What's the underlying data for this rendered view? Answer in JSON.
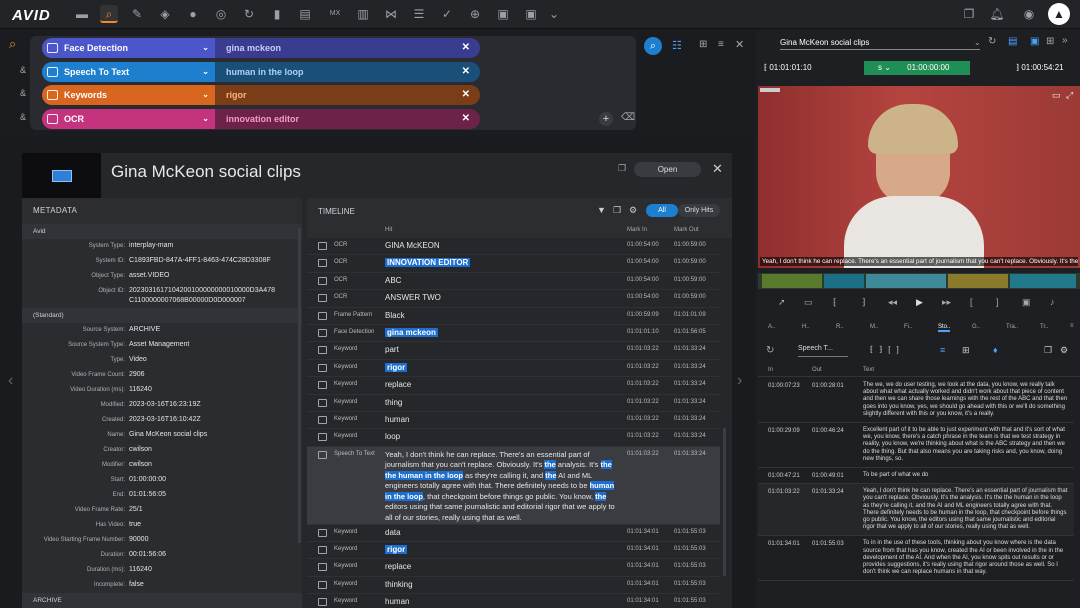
{
  "topbar": {
    "logo": "AVID",
    "icons": [
      "folder-icon",
      "search-icon",
      "edit-icon",
      "diamond-icon",
      "user-icon",
      "target-icon",
      "refresh-icon",
      "bookmark-icon",
      "list-icon",
      "mam-icon",
      "bars-icon",
      "share-icon",
      "sliders-icon",
      "check-icon",
      "globe-icon",
      "box-icon",
      "box2-icon",
      "dropdown-icon"
    ]
  },
  "search": {
    "criteria": [
      {
        "amp": "",
        "field": "Face Detection",
        "value": "gina mckeon",
        "color": "#4a56c9",
        "vcolor": "#3a3d8f",
        "vtext": "#c9cdf5"
      },
      {
        "amp": "&",
        "field": "Speech To Text",
        "value": "human in the loop",
        "color": "#1d7fce",
        "vcolor": "#1a4f7a",
        "vtext": "#a8d3f7"
      },
      {
        "amp": "&",
        "field": "Keywords",
        "value": "rigor",
        "color": "#d9661e",
        "vcolor": "#7a3d18",
        "vtext": "#ffb47a"
      },
      {
        "amp": "&",
        "field": "OCR",
        "value": "innovation editor",
        "color": "#c4337e",
        "vcolor": "#6d2249",
        "vtext": "#f29bc7"
      }
    ]
  },
  "detail": {
    "title": "Gina McKeon social clips",
    "open_label": "Open",
    "metadata_label": "METADATA",
    "timeline_label": "TIMELINE",
    "filter_all": "All",
    "filter_hits": "Only Hits",
    "col_hit": "Hit",
    "col_in": "Mark In",
    "col_out": "Mark Out",
    "meta_groups": [
      {
        "name": "Avid",
        "rows": [
          {
            "k": "System Type:",
            "v": "interplay-mam"
          },
          {
            "k": "System ID:",
            "v": "C1893FBD-847A-4FF1-8463-474C28D3308F"
          },
          {
            "k": "Object Type:",
            "v": "asset.VIDEO"
          },
          {
            "k": "Object ID:",
            "v": "2023031617104200100000000010000D3A478C1100000007068B00000D0D000007"
          }
        ]
      },
      {
        "name": "(Standard)",
        "rows": [
          {
            "k": "Source System:",
            "v": "ARCHIVE"
          },
          {
            "k": "Source System Type:",
            "v": "Asset Management"
          },
          {
            "k": "Type:",
            "v": "Video"
          },
          {
            "k": "Video Frame Count:",
            "v": "2906"
          },
          {
            "k": "Video Duration (ms):",
            "v": "116240"
          },
          {
            "k": "Modified:",
            "v": "2023-03-16T16:23:19Z"
          },
          {
            "k": "Created:",
            "v": "2023-03-16T16:10:42Z"
          },
          {
            "k": "Name:",
            "v": "Gina McKeon social clips"
          },
          {
            "k": "Creator:",
            "v": "cwilson"
          },
          {
            "k": "Modifier:",
            "v": "cwilson"
          },
          {
            "k": "Start:",
            "v": "01:00:00:00"
          },
          {
            "k": "End:",
            "v": "01:01:56:05"
          },
          {
            "k": "Video Frame Rate:",
            "v": "25/1"
          },
          {
            "k": "Has Video:",
            "v": "true"
          },
          {
            "k": "Video Starting Frame Number:",
            "v": "90000"
          },
          {
            "k": "Duration:",
            "v": "00:01:56:06"
          },
          {
            "k": "Duration (ms):",
            "v": "116240"
          },
          {
            "k": "Incomplete:",
            "v": "false"
          }
        ]
      },
      {
        "name": "ARCHIVE",
        "rows": []
      }
    ],
    "timeline_rows": [
      {
        "type": "OCR",
        "hit": "GINA McKEON",
        "hl": false,
        "in": "01:00:54:00",
        "out": "01:00:59:00"
      },
      {
        "type": "OCR",
        "hit": "INNOVATION EDITOR",
        "hl": true,
        "in": "01:00:54:00",
        "out": "01:00:59:00"
      },
      {
        "type": "OCR",
        "hit": "ABC",
        "hl": false,
        "in": "01:00:54:00",
        "out": "01:00:59:00"
      },
      {
        "type": "OCR",
        "hit": "ANSWER TWO",
        "hl": false,
        "in": "01:00:54:00",
        "out": "01:00:59:00"
      },
      {
        "type": "Frame Pattern",
        "hit": "Black",
        "hl": false,
        "in": "01:00:59:09",
        "out": "01:01:01:09"
      },
      {
        "type": "Face Detection",
        "hit": "gina mckeon",
        "hl": true,
        "in": "01:01:01:10",
        "out": "01:01:56:05"
      },
      {
        "type": "Keyword",
        "hit": "part",
        "hl": false,
        "in": "01:01:03:22",
        "out": "01:01:33:24"
      },
      {
        "type": "Keyword",
        "hit": "rigor",
        "hl": true,
        "in": "01:01:03:22",
        "out": "01:01:33:24"
      },
      {
        "type": "Keyword",
        "hit": "replace",
        "hl": false,
        "in": "01:01:03:22",
        "out": "01:01:33:24"
      },
      {
        "type": "Keyword",
        "hit": "thing",
        "hl": false,
        "in": "01:01:03:22",
        "out": "01:01:33:24"
      },
      {
        "type": "Keyword",
        "hit": "human",
        "hl": false,
        "in": "01:01:03:22",
        "out": "01:01:33:24"
      },
      {
        "type": "Keyword",
        "hit": "loop",
        "hl": false,
        "in": "01:01:03:22",
        "out": "01:01:33:24"
      }
    ],
    "speech_row": {
      "type": "Speech To Text",
      "in": "01:01:03:22",
      "out": "01:01:33:24",
      "parts": [
        [
          "Yeah, I don't think he can replace. There's an essential part of journalism that you can't replace. Obviously. It's ",
          false
        ],
        [
          "the",
          true
        ],
        [
          " analysis. It's ",
          false
        ],
        [
          "the the human in the loop",
          true
        ],
        [
          " as they're calling it, and ",
          false
        ],
        [
          "the",
          true
        ],
        [
          " AI and ML engineers totally agree with that. There definitely needs to be ",
          false
        ],
        [
          "human in the loop",
          true
        ],
        [
          ", that checkpoint before things go public. You know, ",
          false
        ],
        [
          "the",
          true
        ],
        [
          " editors using that same journalistic and editorial rigor that we apply to all of our stories, really using that as well.",
          false
        ]
      ]
    },
    "timeline_rows2": [
      {
        "type": "Keyword",
        "hit": "data",
        "hl": false,
        "in": "01:01:34:01",
        "out": "01:01:55:03"
      },
      {
        "type": "Keyword",
        "hit": "rigor",
        "hl": true,
        "in": "01:01:34:01",
        "out": "01:01:55:03"
      },
      {
        "type": "Keyword",
        "hit": "replace",
        "hl": false,
        "in": "01:01:34:01",
        "out": "01:01:55:03"
      },
      {
        "type": "Keyword",
        "hit": "thinking",
        "hl": false,
        "in": "01:01:34:01",
        "out": "01:01:55:03"
      },
      {
        "type": "Keyword",
        "hit": "human",
        "hl": false,
        "in": "01:01:34:01",
        "out": "01:01:55:03"
      }
    ]
  },
  "player": {
    "title": "Gina McKeon social clips",
    "tc_in": "01:01:01:10",
    "tc_mode": "s",
    "tc_current": "01:00:00:00",
    "tc_out": "01:00:54:21",
    "subtitle": "Yeah, I don't think he can replace. There's an essential part of journalism that you can't replace. Obviously. It's the",
    "tabs": [
      "A..",
      "H..",
      "R..",
      "M..",
      "Fi..",
      "Sto..",
      "G..",
      "Tra..",
      "Tr.."
    ],
    "track_select": "Speech T...",
    "col_in": "In",
    "col_out": "Out",
    "col_text": "Text",
    "rows": [
      {
        "in": "01:00:07:23",
        "out": "01:00:28:01",
        "text": "The we, we do user testing, we look at the data, you know, we really talk about what what actually worked and didn't work about that piece of content and then we can share those learnings with the rest of the ABC and that then goes into you know, yes, we should go ahead with this or we'll do something slightly different with this or you know, it's a really."
      },
      {
        "in": "01:00:29:09",
        "out": "01:00:46:24",
        "text": "Excellent part of it to be able to just experiment with that and it's sort of what we, you know, there's a catch phrase in the team is that we test strategy in reality, you know, we're thinking about what is the ABC strategy and then we do the thing. But that also means you are taking risks and, you know, doing new things, so."
      },
      {
        "in": "01:00:47:21",
        "out": "01:00:49:01",
        "text": "To be part of what we do"
      },
      {
        "in": "01:01:03:22",
        "out": "01:01:33:24",
        "text": "Yeah, I don't think he can replace. There's an essential part of journalism that you can't replace. Obviously. It's the analysis. It's the the human in the loop as they're calling it, and the AI and ML engineers totally agree with that. There definitely needs to be human in the loop, that checkpoint before things go public. You know, the editors using that same journalistic and editorial rigor that we apply to all of our stories, really using that as well."
      },
      {
        "in": "01:01:34:01",
        "out": "01:01:55:03",
        "text": "To in in the use of these tools, thinking about you know where is the data source from that has you know, created the AI or been involved in the in the development of the AI. And when the AI, you know spits out results or or provides suggestions, it's really using that rigor around those as well. So I don't think we can replace humans in that way."
      }
    ]
  },
  "colors": {
    "accent": "#1d6fcf",
    "search_orange": "#f08a2b",
    "tc_green": "#1f8f55"
  }
}
